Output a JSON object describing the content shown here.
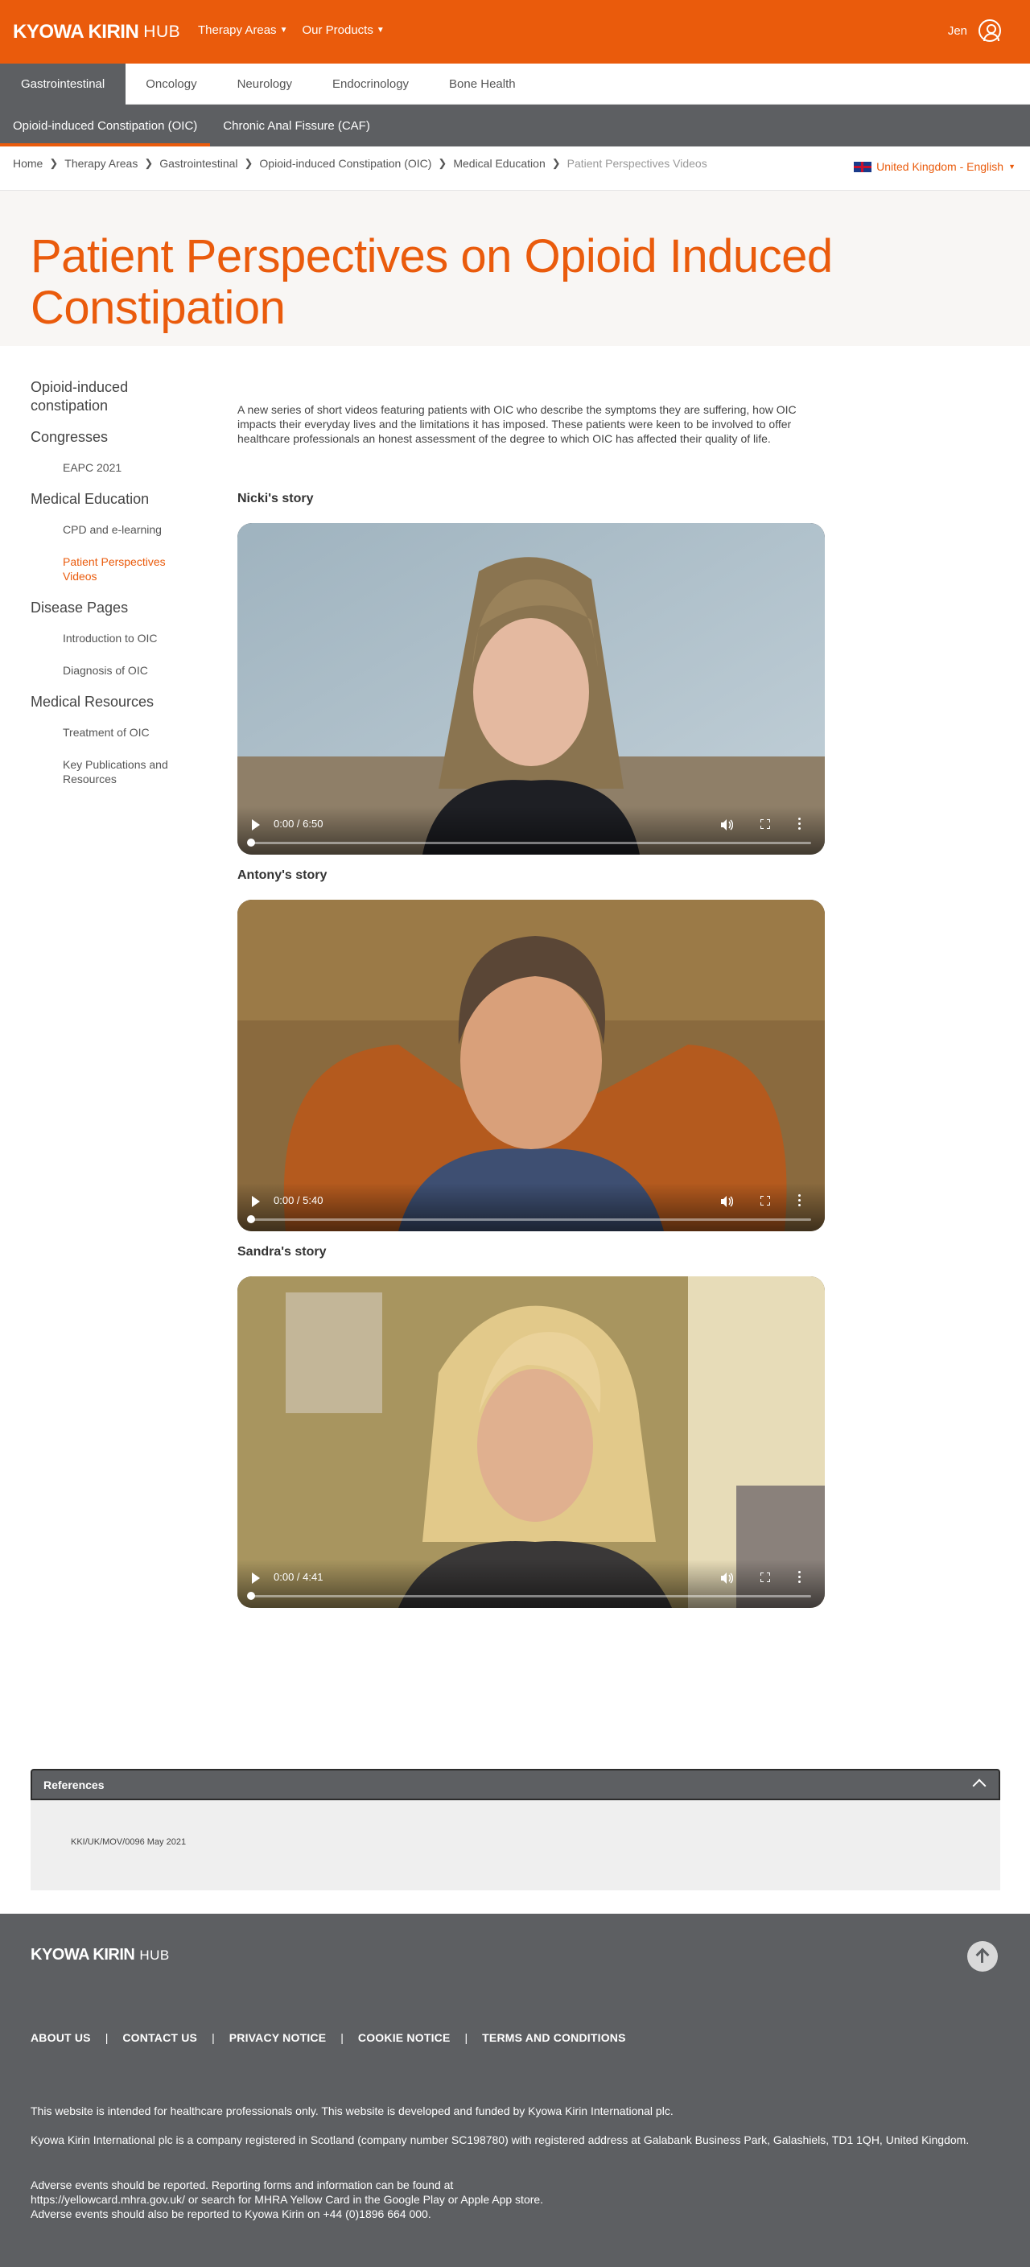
{
  "header": {
    "brand": "KYOWA KIRIN",
    "hub": "HUB",
    "nav": [
      "Therapy Areas",
      "Our Products"
    ],
    "user": "Jen"
  },
  "therapy_tabs": [
    "Gastrointestinal",
    "Oncology",
    "Neurology",
    "Endocrinology",
    "Bone Health"
  ],
  "sub_tabs": [
    "Opioid-induced Constipation (OIC)",
    "Chronic Anal Fissure (CAF)"
  ],
  "breadcrumb": [
    "Home",
    "Therapy Areas",
    "Gastrointestinal",
    "Opioid-induced Constipation (OIC)",
    "Medical Education",
    "Patient Perspectives Videos"
  ],
  "locale": "United Kingdom - English",
  "page_title": "Patient Perspectives on Opioid Induced Constipation",
  "sidebar": {
    "oic": "Opioid-induced constipation",
    "congresses": "Congresses",
    "eapc": "EAPC 2021",
    "medical_education": "Medical Education",
    "cpd": "CPD and e-learning",
    "patient_videos": "Patient Perspectives Videos",
    "disease_pages": "Disease Pages",
    "intro_oic": "Introduction to OIC",
    "diagnosis_oic": "Diagnosis of OIC",
    "medical_resources": "Medical Resources",
    "treatment_oic": "Treatment of OIC",
    "key_pubs": "Key Publications and Resources"
  },
  "intro": "A new series of short videos featuring patients with OIC who describe the symptoms they are suffering, how OIC impacts their everyday lives and the limitations it has imposed. These patients were keen to be involved to offer healthcare professionals an honest assessment of the degree to which OIC has affected their quality of life.",
  "videos": [
    {
      "title": "Nicki's story",
      "time": "0:00 / 6:50"
    },
    {
      "title": "Antony's story",
      "time": "0:00 / 5:40"
    },
    {
      "title": "Sandra's story",
      "time": "0:00 / 4:41"
    }
  ],
  "references": {
    "title": "References",
    "code": "KKI/UK/MOV/0096   May 2021"
  },
  "footer": {
    "links": [
      "ABOUT US",
      "CONTACT US",
      "PRIVACY NOTICE",
      "COOKIE NOTICE",
      "TERMS AND CONDITIONS"
    ],
    "p1": "This website is intended for healthcare professionals only. This website is developed and funded by Kyowa Kirin International plc.",
    "p2": "Kyowa Kirin International plc is a company registered in Scotland (company number SC198780) with registered address at Galabank Business Park, Galashiels, TD1 1QH, United Kingdom.",
    "p3a": "Adverse events should be reported. Reporting forms and information can be found at",
    "p3b": "https://yellowcard.mhra.gov.uk/ or search for MHRA Yellow Card in the Google Play or Apple App store.",
    "p3c": "Adverse events should also be reported to Kyowa Kirin on +44 (0)1896 664 000."
  },
  "colors": {
    "brand": "#ea5b0c",
    "nav_grey": "#5d5f62"
  }
}
